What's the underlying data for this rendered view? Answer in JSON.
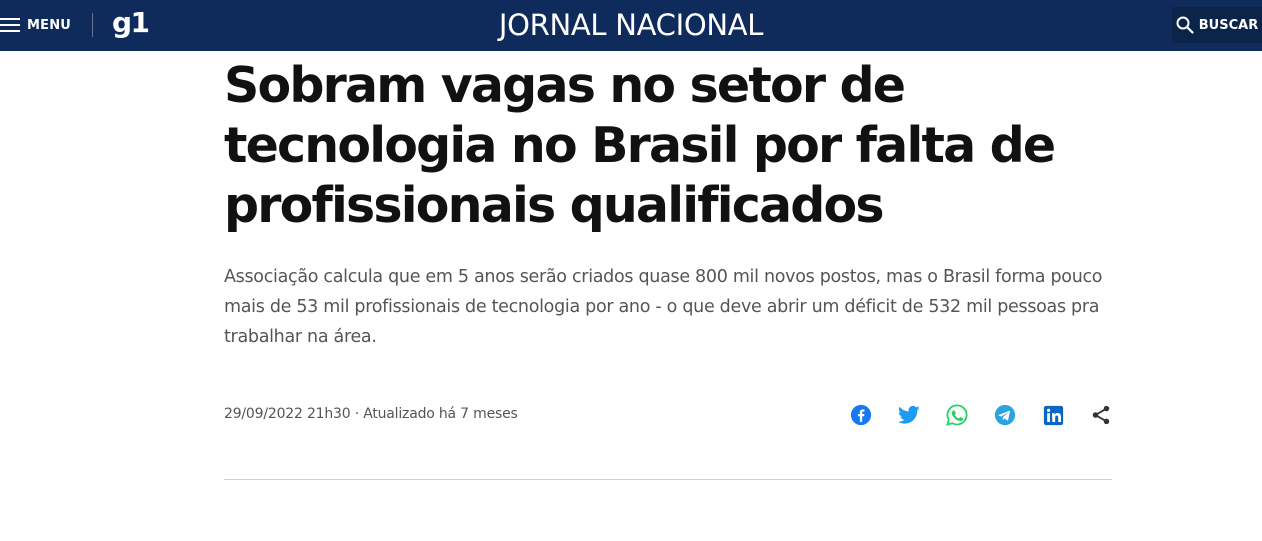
{
  "header": {
    "menu_label": "MENU",
    "logo_text": "g1",
    "program_title": "JORNAL NACIONAL",
    "search_label": "BUSCAR",
    "background_color": "#0f2b5b"
  },
  "article": {
    "headline": "Sobram vagas no setor de tecnologia no Brasil por falta de profissionais qualificados",
    "subtitle": "Associação calcula que em 5 anos serão criados quase 800 mil novos postos, mas o Brasil forma pouco mais de 53 mil profissionais de tecnologia por ano - o que deve abrir um déficit de 532 mil pessoas pra trabalhar na área.",
    "meta": "29/09/2022 21h30 · Atualizado há 7 meses"
  },
  "share_icons": [
    {
      "icon": "facebook-icon",
      "color": "#1877f2"
    },
    {
      "icon": "twitter-icon",
      "color": "#1d9bf0"
    },
    {
      "icon": "whatsapp-icon",
      "color": "#25d366"
    },
    {
      "icon": "telegram-icon",
      "color": "#2aa3de"
    },
    {
      "icon": "linkedin-icon",
      "color": "#0a66c2"
    },
    {
      "icon": "share-icon",
      "color": "#333333"
    }
  ]
}
